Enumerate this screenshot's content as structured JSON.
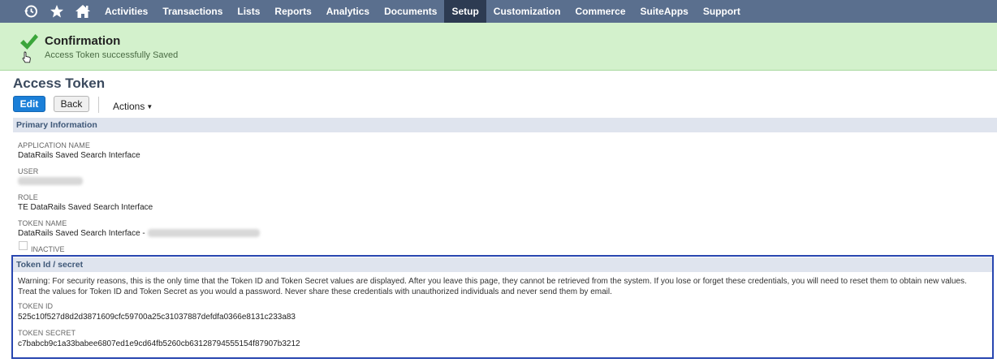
{
  "nav": {
    "icons": [
      "recent-history-icon",
      "star-icon",
      "home-icon"
    ],
    "items": [
      {
        "label": "Activities"
      },
      {
        "label": "Transactions"
      },
      {
        "label": "Lists"
      },
      {
        "label": "Reports"
      },
      {
        "label": "Analytics"
      },
      {
        "label": "Documents"
      },
      {
        "label": "Setup",
        "active": true
      },
      {
        "label": "Customization"
      },
      {
        "label": "Commerce"
      },
      {
        "label": "SuiteApps"
      },
      {
        "label": "Support"
      }
    ]
  },
  "confirmation": {
    "title": "Confirmation",
    "message": "Access Token successfully Saved"
  },
  "page": {
    "title": "Access Token"
  },
  "toolbar": {
    "edit_label": "Edit",
    "back_label": "Back",
    "actions_label": "Actions"
  },
  "primary": {
    "header": "Primary Information",
    "application_name_label": "APPLICATION NAME",
    "application_name_value": "DataRails Saved Search Interface",
    "user_label": "USER",
    "role_label": "ROLE",
    "role_value": "TE DataRails Saved Search Interface",
    "token_name_label": "TOKEN NAME",
    "token_name_value": "DataRails Saved Search Interface -",
    "inactive_label": "INACTIVE"
  },
  "token_section": {
    "header": "Token Id / secret",
    "warning_line1": "Warning: For security reasons, this is the only time that the Token ID and Token Secret values are displayed. After you leave this page, they cannot be retrieved from the system. If you lose or forget these credentials, you will need to reset them to obtain new values.",
    "warning_line2": "Treat the values for Token ID and Token Secret as you would a password. Never share these credentials with unauthorized individuals and never send them by email.",
    "token_id_label": "TOKEN ID",
    "token_id_value": "525c10f527d8d2d3871609cfc59700a25c31037887defdfa0366e8131c233a83",
    "token_secret_label": "TOKEN SECRET",
    "token_secret_value": "c7babcb9c1a33babee6807ed1e9cd64fb5260cb63128794555154f87907b3212"
  },
  "colors": {
    "nav_bg": "#5a6f8e",
    "nav_active": "#2d3b52",
    "confirm_bg": "#d3f1cc",
    "check_green": "#3aa53a",
    "edit_blue": "#1b7fd8",
    "section_bg": "#dfe4ee",
    "highlight_border": "#2846b0"
  }
}
